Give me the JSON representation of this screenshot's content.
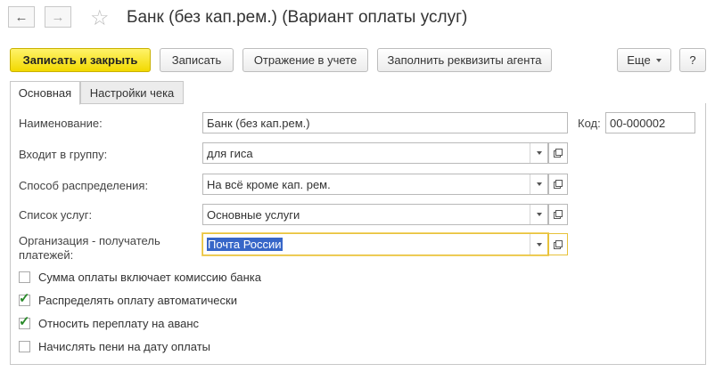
{
  "window": {
    "title": "Банк (без кап.рем.) (Вариант оплаты услуг)"
  },
  "toolbar": {
    "save_close_label": "Записать и закрыть",
    "save_label": "Записать",
    "posting_label": "Отражение в учете",
    "fill_agent_label": "Заполнить реквизиты агента",
    "more_label": "Еще",
    "help_label": "?"
  },
  "tabs": [
    {
      "label": "Основная",
      "active": true
    },
    {
      "label": "Настройки чека",
      "active": false
    }
  ],
  "form": {
    "name_label": "Наименование:",
    "name_value": "Банк (без кап.рем.)",
    "code_label": "Код:",
    "code_value": "00-000002",
    "group_label": "Входит в группу:",
    "group_value": "для гиса",
    "distribution_label": "Способ распределения:",
    "distribution_value": "На всё кроме кап. рем.",
    "services_label": "Список услуг:",
    "services_value": "Основные услуги",
    "org_label_line1": "Организация - получатель",
    "org_label_line2": "платежей:",
    "org_value": "Почта России"
  },
  "checkboxes": [
    {
      "label": "Сумма оплаты включает комиссию банка",
      "checked": false
    },
    {
      "label": "Распределять оплату автоматически",
      "checked": true
    },
    {
      "label": "Относить переплату на аванс",
      "checked": true
    },
    {
      "label": "Начислять пени на дату оплаты",
      "checked": false
    }
  ],
  "colors": {
    "primary_button": "#f2d900",
    "selection": "#3766c8",
    "focus_border": "#e7c23b",
    "check": "#2a8a2a"
  },
  "icons": {
    "back": "arrow-left-icon",
    "forward": "arrow-right-icon",
    "favorite": "star-icon",
    "dropdown": "chevron-down-icon",
    "open": "open-form-icon"
  }
}
